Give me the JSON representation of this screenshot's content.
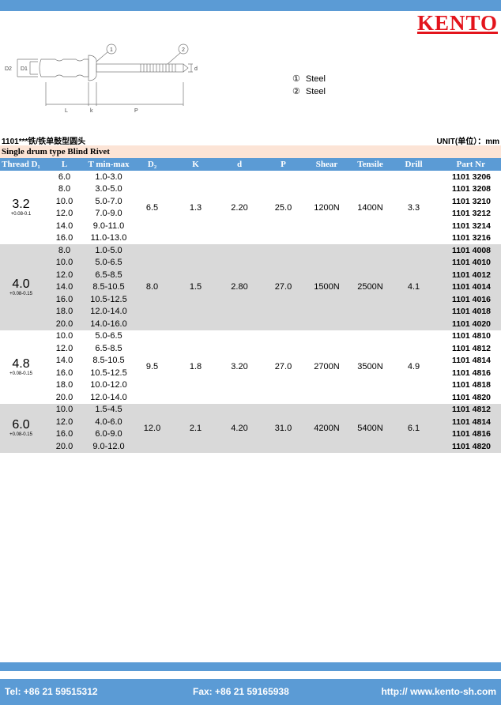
{
  "brand": {
    "logo": "KENTO"
  },
  "drawing": {
    "labels": {
      "d2": "D2",
      "d1": "D1",
      "l": "L",
      "k": "k",
      "p": "P",
      "d": "d",
      "callout1": "1",
      "callout2": "2"
    }
  },
  "legend": [
    {
      "num": "①",
      "material": "Steel"
    },
    {
      "num": "②",
      "material": "Steel"
    }
  ],
  "title": "1101***铁/铁单鼓型圆头",
  "unit": "UNIT(单位）：mm",
  "subtitle": "Single drum type Blind Rivet",
  "table": {
    "headers": [
      "Thread D₁",
      "L",
      "T min-max",
      "D₂",
      "K",
      "d",
      "P",
      "Shear",
      "Tensile",
      "Drill",
      "Part Nr"
    ],
    "groups": [
      {
        "diameter": "3.2",
        "tolerance": "+0.08-0.1",
        "d2": "6.5",
        "k": "1.3",
        "d": "2.20",
        "p": "25.0",
        "shear": "1200N",
        "tensile": "1400N",
        "drill": "3.3",
        "rows": [
          {
            "l": "6.0",
            "t": "1.0-3.0",
            "part": "1101 3206"
          },
          {
            "l": "8.0",
            "t": "3.0-5.0",
            "part": "1101 3208"
          },
          {
            "l": "10.0",
            "t": "5.0-7.0",
            "part": "1101 3210"
          },
          {
            "l": "12.0",
            "t": "7.0-9.0",
            "part": "1101 3212"
          },
          {
            "l": "14.0",
            "t": "9.0-11.0",
            "part": "1101 3214"
          },
          {
            "l": "16.0",
            "t": "11.0-13.0",
            "part": "1101 3216"
          }
        ]
      },
      {
        "diameter": "4.0",
        "tolerance": "+0.08-0.15",
        "d2": "8.0",
        "k": "1.5",
        "d": "2.80",
        "p": "27.0",
        "shear": "1500N",
        "tensile": "2500N",
        "drill": "4.1",
        "rows": [
          {
            "l": "8.0",
            "t": "1.0-5.0",
            "part": "1101 4008"
          },
          {
            "l": "10.0",
            "t": "5.0-6.5",
            "part": "1101 4010"
          },
          {
            "l": "12.0",
            "t": "6.5-8.5",
            "part": "1101 4012"
          },
          {
            "l": "14.0",
            "t": "8.5-10.5",
            "part": "1101 4014"
          },
          {
            "l": "16.0",
            "t": "10.5-12.5",
            "part": "1101 4016"
          },
          {
            "l": "18.0",
            "t": "12.0-14.0",
            "part": "1101 4018"
          },
          {
            "l": "20.0",
            "t": "14.0-16.0",
            "part": "1101 4020"
          }
        ]
      },
      {
        "diameter": "4.8",
        "tolerance": "+0.08-0.15",
        "d2": "9.5",
        "k": "1.8",
        "d": "3.20",
        "p": "27.0",
        "shear": "2700N",
        "tensile": "3500N",
        "drill": "4.9",
        "rows": [
          {
            "l": "10.0",
            "t": "5.0-6.5",
            "part": "1101 4810"
          },
          {
            "l": "12.0",
            "t": "6.5-8.5",
            "part": "1101 4812"
          },
          {
            "l": "14.0",
            "t": "8.5-10.5",
            "part": "1101 4814"
          },
          {
            "l": "16.0",
            "t": "10.5-12.5",
            "part": "1101 4816"
          },
          {
            "l": "18.0",
            "t": "10.0-12.0",
            "part": "1101 4818"
          },
          {
            "l": "20.0",
            "t": "12.0-14.0",
            "part": "1101 4820"
          }
        ]
      },
      {
        "diameter": "6.0",
        "tolerance": "+0.08-0.15",
        "d2": "12.0",
        "k": "2.1",
        "d": "4.20",
        "p": "31.0",
        "shear": "4200N",
        "tensile": "5400N",
        "drill": "6.1",
        "rows": [
          {
            "l": "10.0",
            "t": "1.5-4.5",
            "part": "1101 4812"
          },
          {
            "l": "12.0",
            "t": "4.0-6.0",
            "part": "1101 4814"
          },
          {
            "l": "16.0",
            "t": "6.0-9.0",
            "part": "1101 4816"
          },
          {
            "l": "20.0",
            "t": "9.0-12.0",
            "part": "1101 4820"
          }
        ]
      }
    ]
  },
  "footer": {
    "tel": "Tel: +86 21 59515312",
    "fax": "Fax: +86 21 59165938",
    "web": "http:// www.kento-sh.com"
  }
}
